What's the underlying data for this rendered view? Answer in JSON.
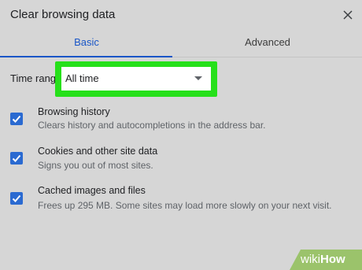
{
  "dialog": {
    "title": "Clear browsing data"
  },
  "tabs": [
    {
      "label": "Basic",
      "active": true
    },
    {
      "label": "Advanced",
      "active": false
    }
  ],
  "time_range": {
    "label": "Time range",
    "value": "All time"
  },
  "options": [
    {
      "title": "Browsing history",
      "description": "Clears history and autocompletions in the address bar.",
      "checked": true
    },
    {
      "title": "Cookies and other site data",
      "description": "Signs you out of most sites.",
      "checked": true
    },
    {
      "title": "Cached images and files",
      "description": "Frees up 295 MB. Some sites may load more slowly on your next visit.",
      "checked": true
    }
  ],
  "watermark": {
    "prefix": "wiki",
    "suffix": "How"
  },
  "colors": {
    "accent": "#1a56c7",
    "checkbox": "#2a6ad1",
    "highlight": "#26e01a",
    "background": "#d6d6d6"
  },
  "icons": {
    "close": "close-icon",
    "dropdown": "chevron-down-icon",
    "check": "check-icon"
  }
}
